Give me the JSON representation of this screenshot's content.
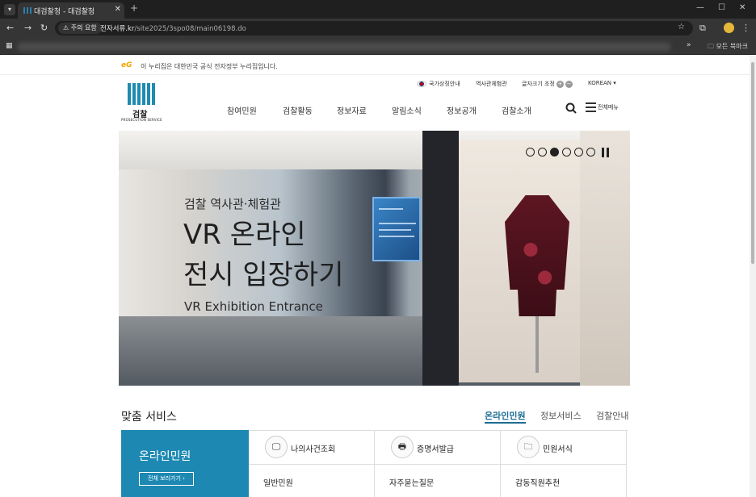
{
  "browser": {
    "tab_title": "대검찰청 - 대검찰청",
    "tab_close": "✕",
    "new_tab": "+",
    "security_label": "⚠ 주의 요함",
    "url_host": "전자서류.kr",
    "url_path": "/site2025/3spo08/main06198.do",
    "bookmarks_more": "»",
    "bookmarks_folder": "모든 북마크"
  },
  "site": {
    "gov_banner": "이 누리집은 대한민국 공식 전자정부 누리집입니다.",
    "eg_logo": "eG",
    "util": {
      "national_symbol": "국가상징안내",
      "history_hall": "역사관체험관",
      "font_size": "글자크기 조정",
      "font_plus": "+",
      "font_minus": "−",
      "language": "KOREAN ▾"
    },
    "logo": {
      "name": "검찰",
      "subtitle": "PROSECUTION SERVICE"
    },
    "gnb": [
      "참여민원",
      "검찰활동",
      "정보자료",
      "알림소식",
      "정보공개",
      "검찰소개"
    ],
    "all_menu": "전체메뉴"
  },
  "hero": {
    "kicker": "검찰 역사관·체험관",
    "title_line1": "VR 온라인",
    "title_line2": "전시 입장하기",
    "subtitle": "VR Exhibition Entrance",
    "slide_count": 6,
    "active_slide": 3
  },
  "services": {
    "title": "맞춤 서비스",
    "tabs": [
      "온라인민원",
      "정보서비스",
      "검찰안내"
    ],
    "active_tab": 0,
    "lead_title": "온라인민원",
    "lead_button": "전체 보러가기 ›",
    "items": [
      {
        "label": "나의사건조회",
        "icon": "monitor-search-icon",
        "glyph": "🖵"
      },
      {
        "label": "증명서발급",
        "icon": "printer-icon",
        "glyph": "🖶"
      },
      {
        "label": "민원서식",
        "icon": "folder-icon",
        "glyph": "🗀"
      },
      {
        "label": "일반민원"
      },
      {
        "label": "자주묻는질문"
      },
      {
        "label": "감동직원추천"
      }
    ]
  }
}
